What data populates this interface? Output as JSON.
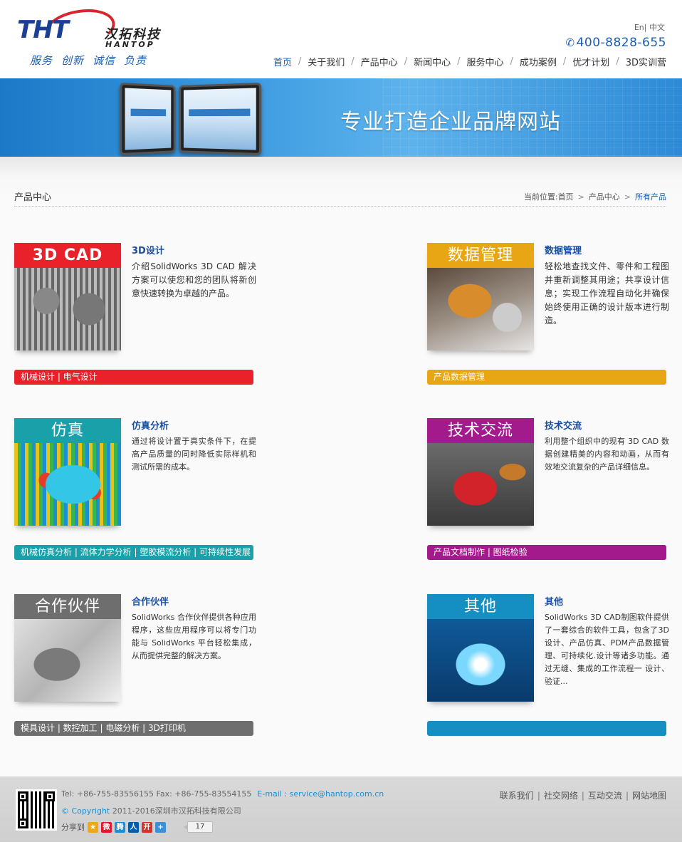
{
  "header": {
    "logo_mark": "THT",
    "logo_cn": "汉拓科技",
    "logo_en": "HANTOP",
    "slogan": [
      "服务",
      "创新",
      "诚信",
      "负责"
    ],
    "lang_en": "En",
    "lang_sep": "|",
    "lang_cn": "中文",
    "phone": "400-8828-655",
    "nav": [
      {
        "label": "首页",
        "active": true
      },
      {
        "label": "关于我们",
        "active": false
      },
      {
        "label": "产品中心",
        "active": false
      },
      {
        "label": "新闻中心",
        "active": false
      },
      {
        "label": "服务中心",
        "active": false
      },
      {
        "label": "成功案例",
        "active": false
      },
      {
        "label": "优才计划",
        "active": false
      },
      {
        "label": "3D实训营",
        "active": false
      }
    ]
  },
  "banner": {
    "text": "专业打造企业品牌网站"
  },
  "page": {
    "title": "产品中心",
    "breadcrumb_prefix": "当前位置:",
    "breadcrumb": [
      "首页",
      "产品中心",
      "所有产品"
    ]
  },
  "products": [
    {
      "label": "3D CAD",
      "label_color": "#e8212b",
      "title": "3D设计",
      "desc": "介绍SolidWorks 3D CAD 解决方案可以使您和您的团队将新创意快速转换为卓越的产品。",
      "tags": "机械设计 | 电气设计",
      "tag_color": "#e8212b"
    },
    {
      "label": "数据管理",
      "label_color": "#e8a514",
      "title": "数据管理",
      "desc": "轻松地查找文件、零件和工程图并重新调整其用途；共享设计信息；实现工作流程自动化并确保始终使用正确的设计版本进行制造。",
      "tags": "产品数据管理",
      "tag_color": "#e8a514"
    },
    {
      "label": "仿真",
      "label_color": "#1aa0a8",
      "title": "仿真分析",
      "desc": "通过将设计置于真实条件下，在提高产品质量的同时降低实际样机和测试所需的成本。",
      "tags": "机械仿真分析 | 流体力学分析 | 塑胶模流分析 | 可持续性发展",
      "tag_color": "#1aa0a8"
    },
    {
      "label": "技术交流",
      "label_color": "#a21a8c",
      "title": "技术交流",
      "desc": "利用整个组织中的现有 3D CAD 数据创建精美的内容和动画，从而有效地交流复杂的产品详细信息。",
      "tags": "产品文档制作 | 图纸检验",
      "tag_color": "#a21a8c"
    },
    {
      "label": "合作伙伴",
      "label_color": "#6e6e6e",
      "title": "合作伙伴",
      "desc": "SolidWorks 合作伙伴提供各种应用程序，这些应用程序可以将专门功能与 SolidWorks 平台轻松集成，从而提供完整的解决方案。",
      "tags": "模具设计 | 数控加工 | 电磁分析 | 3D打印机",
      "tag_color": "#6e6e6e"
    },
    {
      "label": "其他",
      "label_color": "#158fc2",
      "title": "其他",
      "desc": "SolidWorks 3D CAD制图软件提供了一套综合的软件工具，包含了3D设计、产品仿真、PDM产品数据管理、可持续化.设计等诸多功能。通过无缝、集成的工作流程一 设计、验证...",
      "tags": "",
      "tag_color": "#158fc2"
    }
  ],
  "footer": {
    "contact": "Tel: +86-755-83556155  Fax: +86-755-83554155",
    "email": "E-mail : service@hantop.com.cn",
    "copyright_symbol": "© Copyright",
    "copyright_text": "2011-2016深圳市汉拓科技有限公司",
    "share_label": "分享到",
    "share_icons": [
      {
        "name": "qzone-icon",
        "glyph": "★",
        "color": "#f0a818"
      },
      {
        "name": "weibo-icon",
        "glyph": "微",
        "color": "#e6162d"
      },
      {
        "name": "tqq-icon",
        "glyph": "腾",
        "color": "#1b8fd6"
      },
      {
        "name": "renren-icon",
        "glyph": "人",
        "color": "#005eac"
      },
      {
        "name": "kaixin-icon",
        "glyph": "开",
        "color": "#d6322a"
      },
      {
        "name": "more-icon",
        "glyph": "+",
        "color": "#3d8fd6"
      }
    ],
    "share_count": "17",
    "links": [
      "联系我们",
      "社交网络",
      "互动交流",
      "网站地图"
    ]
  }
}
